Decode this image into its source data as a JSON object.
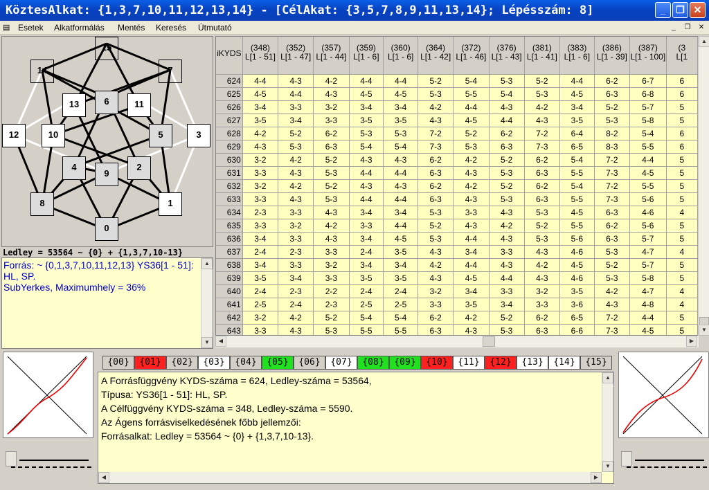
{
  "window": {
    "title": "KöztesAlkat: {1,3,7,10,11,12,13,14} - [CélAkat: {3,5,7,8,9,11,13,14}; Lépésszám: 8]",
    "minimize": "_",
    "restore": "❐",
    "close": "✕"
  },
  "menu": {
    "items": [
      "Esetek",
      "Alkatformálás",
      "Mentés",
      "Keresés",
      "Útmutató"
    ]
  },
  "graph": {
    "nodes": [
      {
        "label": "15",
        "style": "w"
      },
      {
        "label": "14",
        "style": "w"
      },
      {
        "label": "7",
        "style": "w"
      },
      {
        "label": "6",
        "style": "g"
      },
      {
        "label": "13",
        "style": "w"
      },
      {
        "label": "11",
        "style": "w"
      },
      {
        "label": "12",
        "style": "w"
      },
      {
        "label": "10",
        "style": "w"
      },
      {
        "label": "5",
        "style": "g"
      },
      {
        "label": "3",
        "style": "w"
      },
      {
        "label": "4",
        "style": "g"
      },
      {
        "label": "9",
        "style": "g"
      },
      {
        "label": "2",
        "style": "g"
      },
      {
        "label": "8",
        "style": "g"
      },
      {
        "label": "1",
        "style": "w"
      },
      {
        "label": "0",
        "style": "g"
      }
    ]
  },
  "ledley_caption": "Ledley = 53564 ~ {0} + {1,3,7,10-13}",
  "source_text": "Forrás: ~ {0,1,3,7,10,11,12,13} YS36[1 - 51]: HL, SP.",
  "source_sub": "SubYerkes, Maximumhely = 36%",
  "table": {
    "corner": "iKYDS",
    "columns": [
      {
        "top": "(348)",
        "bot": "L[1 - 51]"
      },
      {
        "top": "(352)",
        "bot": "L[1 - 47]"
      },
      {
        "top": "(357)",
        "bot": "L[1 - 44]"
      },
      {
        "top": "(359)",
        "bot": "L[1 - 6]"
      },
      {
        "top": "(360)",
        "bot": "L[1 - 6]"
      },
      {
        "top": "(364)",
        "bot": "L[1 - 42]"
      },
      {
        "top": "(372)",
        "bot": "L[1 - 46]"
      },
      {
        "top": "(376)",
        "bot": "L[1 - 43]"
      },
      {
        "top": "(381)",
        "bot": "L[1 - 41]"
      },
      {
        "top": "(383)",
        "bot": "L[1 - 6]"
      },
      {
        "top": "(386)",
        "bot": "L[1 - 39]"
      },
      {
        "top": "(387)",
        "bot": "L[1 - 100]"
      },
      {
        "top": "(3",
        "bot": "L[1"
      }
    ],
    "rows": [
      {
        "id": "624",
        "cells": [
          "4-4",
          "4-3",
          "4-2",
          "4-4",
          "4-4",
          "5-2",
          "5-4",
          "5-3",
          "5-2",
          "4-4",
          "6-2",
          "6-7",
          "6"
        ]
      },
      {
        "id": "625",
        "cells": [
          "4-5",
          "4-4",
          "4-3",
          "4-5",
          "4-5",
          "5-3",
          "5-5",
          "5-4",
          "5-3",
          "4-5",
          "6-3",
          "6-8",
          "6"
        ]
      },
      {
        "id": "626",
        "cells": [
          "3-4",
          "3-3",
          "3-2",
          "3-4",
          "3-4",
          "4-2",
          "4-4",
          "4-3",
          "4-2",
          "3-4",
          "5-2",
          "5-7",
          "5"
        ]
      },
      {
        "id": "627",
        "cells": [
          "3-5",
          "3-4",
          "3-3",
          "3-5",
          "3-5",
          "4-3",
          "4-5",
          "4-4",
          "4-3",
          "3-5",
          "5-3",
          "5-8",
          "5"
        ]
      },
      {
        "id": "628",
        "cells": [
          "4-2",
          "5-2",
          "6-2",
          "5-3",
          "5-3",
          "7-2",
          "5-2",
          "6-2",
          "7-2",
          "6-4",
          "8-2",
          "5-4",
          "6"
        ]
      },
      {
        "id": "629",
        "cells": [
          "4-3",
          "5-3",
          "6-3",
          "5-4",
          "5-4",
          "7-3",
          "5-3",
          "6-3",
          "7-3",
          "6-5",
          "8-3",
          "5-5",
          "6"
        ]
      },
      {
        "id": "630",
        "cells": [
          "3-2",
          "4-2",
          "5-2",
          "4-3",
          "4-3",
          "6-2",
          "4-2",
          "5-2",
          "6-2",
          "5-4",
          "7-2",
          "4-4",
          "5"
        ]
      },
      {
        "id": "631",
        "cells": [
          "3-3",
          "4-3",
          "5-3",
          "4-4",
          "4-4",
          "6-3",
          "4-3",
          "5-3",
          "6-3",
          "5-5",
          "7-3",
          "4-5",
          "5"
        ]
      },
      {
        "id": "632",
        "cells": [
          "3-2",
          "4-2",
          "5-2",
          "4-3",
          "4-3",
          "6-2",
          "4-2",
          "5-2",
          "6-2",
          "5-4",
          "7-2",
          "5-5",
          "5"
        ]
      },
      {
        "id": "633",
        "cells": [
          "3-3",
          "4-3",
          "5-3",
          "4-4",
          "4-4",
          "6-3",
          "4-3",
          "5-3",
          "6-3",
          "5-5",
          "7-3",
          "5-6",
          "5"
        ]
      },
      {
        "id": "634",
        "cells": [
          "2-3",
          "3-3",
          "4-3",
          "3-4",
          "3-4",
          "5-3",
          "3-3",
          "4-3",
          "5-3",
          "4-5",
          "6-3",
          "4-6",
          "4"
        ]
      },
      {
        "id": "635",
        "cells": [
          "3-3",
          "3-2",
          "4-2",
          "3-3",
          "4-4",
          "5-2",
          "4-3",
          "4-2",
          "5-2",
          "5-5",
          "6-2",
          "5-6",
          "5"
        ]
      },
      {
        "id": "636",
        "cells": [
          "3-4",
          "3-3",
          "4-3",
          "3-4",
          "4-5",
          "5-3",
          "4-4",
          "4-3",
          "5-3",
          "5-6",
          "6-3",
          "5-7",
          "5"
        ]
      },
      {
        "id": "637",
        "cells": [
          "2-4",
          "2-3",
          "3-3",
          "2-4",
          "3-5",
          "4-3",
          "3-4",
          "3-3",
          "4-3",
          "4-6",
          "5-3",
          "4-7",
          "4"
        ]
      },
      {
        "id": "638",
        "cells": [
          "3-4",
          "3-3",
          "3-2",
          "3-4",
          "3-4",
          "4-2",
          "4-4",
          "4-3",
          "4-2",
          "4-5",
          "5-2",
          "5-7",
          "5"
        ]
      },
      {
        "id": "639",
        "cells": [
          "3-5",
          "3-4",
          "3-3",
          "3-5",
          "3-5",
          "4-3",
          "4-5",
          "4-4",
          "4-3",
          "4-6",
          "5-3",
          "5-8",
          "5"
        ]
      },
      {
        "id": "640",
        "cells": [
          "2-4",
          "2-3",
          "2-2",
          "2-4",
          "2-4",
          "3-2",
          "3-4",
          "3-3",
          "3-2",
          "3-5",
          "4-2",
          "4-7",
          "4"
        ]
      },
      {
        "id": "641",
        "cells": [
          "2-5",
          "2-4",
          "2-3",
          "2-5",
          "2-5",
          "3-3",
          "3-5",
          "3-4",
          "3-3",
          "3-6",
          "4-3",
          "4-8",
          "4"
        ]
      },
      {
        "id": "642",
        "cells": [
          "3-2",
          "4-2",
          "5-2",
          "5-4",
          "5-4",
          "6-2",
          "4-2",
          "5-2",
          "6-2",
          "6-5",
          "7-2",
          "4-4",
          "5"
        ]
      },
      {
        "id": "643",
        "cells": [
          "3-3",
          "4-3",
          "5-3",
          "5-5",
          "5-5",
          "6-3",
          "4-3",
          "5-3",
          "6-3",
          "6-6",
          "7-3",
          "4-5",
          "5"
        ]
      }
    ]
  },
  "tabs": [
    {
      "label": "{00}",
      "style": "n"
    },
    {
      "label": "{01}",
      "style": "r"
    },
    {
      "label": "{02}",
      "style": "n"
    },
    {
      "label": "{03}",
      "style": "wh"
    },
    {
      "label": "{04}",
      "style": "n"
    },
    {
      "label": "{05}",
      "style": "gr"
    },
    {
      "label": "{06}",
      "style": "n"
    },
    {
      "label": "{07}",
      "style": "wh"
    },
    {
      "label": "{08}",
      "style": "gr"
    },
    {
      "label": "{09}",
      "style": "gr"
    },
    {
      "label": "{10}",
      "style": "r"
    },
    {
      "label": "{11}",
      "style": "wh"
    },
    {
      "label": "{12}",
      "style": "r"
    },
    {
      "label": "{13}",
      "style": "wh"
    },
    {
      "label": "{14}",
      "style": "wh"
    },
    {
      "label": "{15}",
      "style": "n"
    }
  ],
  "info": {
    "lines": [
      "A Forrásfüggvény KYDS-száma = 624, Ledley-száma = 53564,",
      "Típusa: YS36[1 - 51]: HL, SP.",
      "A Célfüggvény KYDS-száma = 348, Ledley-száma = 5590.",
      "Az Ágens forrásviselkedésének főbb jellemzői:",
      "Forrásalkat: Ledley = 53564 ~ {0} + {1,3,7,10-13}."
    ]
  },
  "colors": {
    "cell_bg": "#ffffc0",
    "tab_red": "#ff2020",
    "tab_green": "#20e020",
    "text_blue": "#0000cc"
  }
}
